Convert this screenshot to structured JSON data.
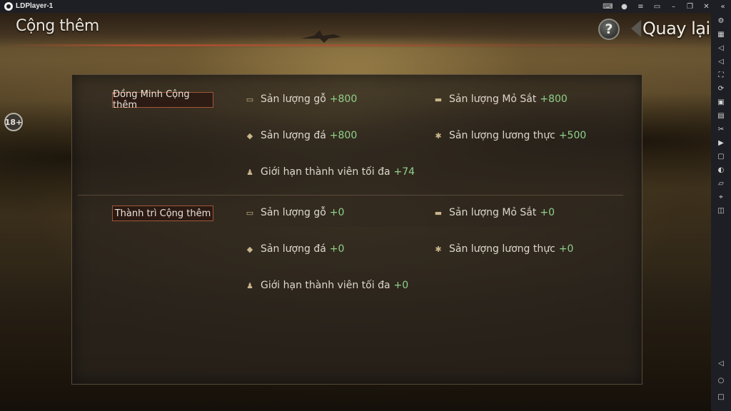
{
  "window": {
    "app_name": "LDPlayer-1"
  },
  "header": {
    "title": "Cộng thêm",
    "help_label": "?",
    "back_label": "Quay lại"
  },
  "age_badge": "18+",
  "sections": [
    {
      "label": "Đồng Minh Cộng thêm",
      "stats": {
        "wood": {
          "label": "Sản lượng gỗ",
          "value": "+800",
          "icon": "wood-icon"
        },
        "iron": {
          "label": "Sản lượng Mỏ Sắt",
          "value": "+800",
          "icon": "anvil-icon"
        },
        "stone": {
          "label": "Sản lượng đá",
          "value": "+800",
          "icon": "stone-icon"
        },
        "food": {
          "label": "Sản lượng lương thực",
          "value": "+500",
          "icon": "wheat-icon"
        },
        "members": {
          "label": "Giới hạn thành viên tối đa",
          "value": "+74",
          "icon": "members-icon"
        }
      }
    },
    {
      "label": "Thành trì Cộng thêm",
      "stats": {
        "wood": {
          "label": "Sản lượng gỗ",
          "value": "+0",
          "icon": "wood-icon"
        },
        "iron": {
          "label": "Sản lượng Mỏ Sắt",
          "value": "+0",
          "icon": "anvil-icon"
        },
        "stone": {
          "label": "Sản lượng đá",
          "value": "+0",
          "icon": "stone-icon"
        },
        "food": {
          "label": "Sản lượng lương thực",
          "value": "+0",
          "icon": "wheat-icon"
        },
        "members": {
          "label": "Giới hạn thành viên tối đa",
          "value": "+0",
          "icon": "members-icon"
        }
      }
    }
  ],
  "colors": {
    "value_green": "#8fd18a",
    "label_border": "#a0563a"
  }
}
